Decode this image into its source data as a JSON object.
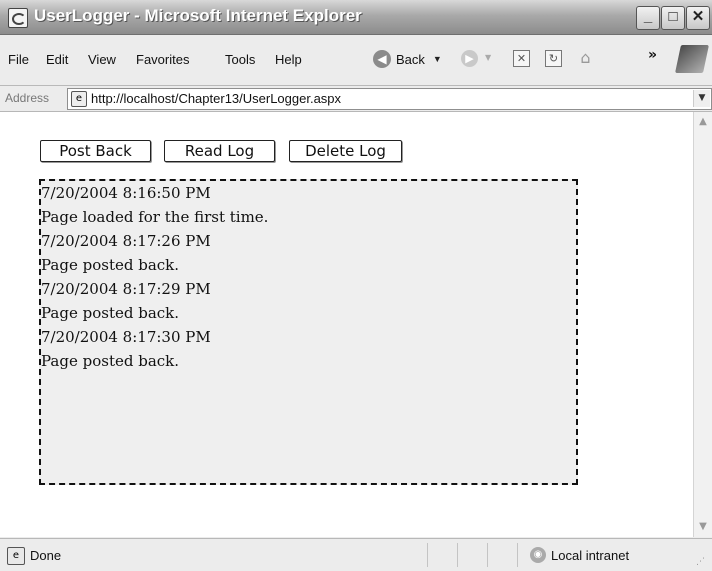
{
  "window": {
    "title": "UserLogger - Microsoft Internet Explorer",
    "controls": {
      "minimize": "_",
      "maximize": "□",
      "close": "✕"
    }
  },
  "menu": {
    "items": [
      {
        "label": "File"
      },
      {
        "label": "Edit"
      },
      {
        "label": "View"
      },
      {
        "label": "Favorites"
      },
      {
        "label": "Tools"
      },
      {
        "label": "Help"
      }
    ]
  },
  "toolbar": {
    "back_label": "Back",
    "chevron": "»"
  },
  "address": {
    "label": "Address",
    "url": "http://localhost/Chapter13/UserLogger.aspx"
  },
  "page": {
    "buttons": {
      "post_back": "Post Back",
      "read_log": "Read Log",
      "delete_log": "Delete Log"
    },
    "log_lines": [
      "7/20/2004 8:16:50 PM",
      "Page loaded for the first time.",
      "7/20/2004 8:17:26 PM",
      "Page posted back.",
      "7/20/2004 8:17:29 PM",
      "Page posted back.",
      "7/20/2004 8:17:30 PM",
      "Page posted back."
    ]
  },
  "status": {
    "text": "Done",
    "zone": "Local intranet"
  }
}
